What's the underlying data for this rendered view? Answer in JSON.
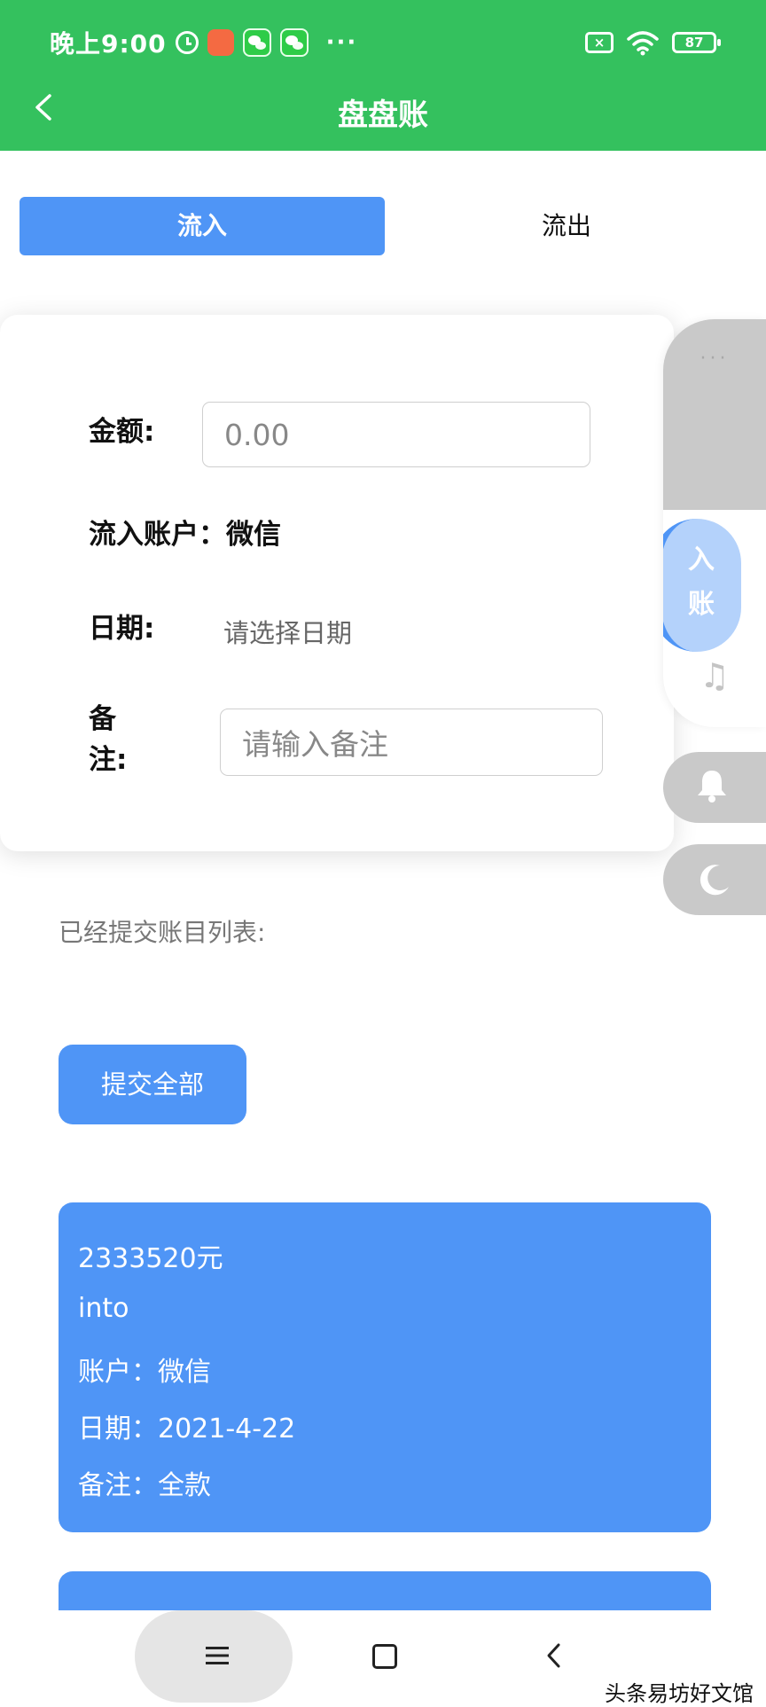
{
  "status_bar": {
    "time": "晚上9:00",
    "more": "···",
    "battery": "87",
    "sim": "×"
  },
  "header": {
    "title": "盘盘账"
  },
  "tabs": [
    {
      "label": "流入"
    },
    {
      "label": "流出"
    }
  ],
  "form": {
    "amount_label": "金额:",
    "amount_placeholder": "0.00",
    "account_label": "流入账户：微信",
    "date_label": "日期:",
    "date_placeholder": "请选择日期",
    "note_label_1": "备",
    "note_label_2": "注:",
    "note_placeholder": "请输入备注"
  },
  "float_menu": {
    "dots": "···",
    "active_1": "入",
    "active_2": "账",
    "music": "♫"
  },
  "list": {
    "title": "已经提交账目列表:",
    "submit_label": "提交全部",
    "entries": [
      {
        "amount": "2333520元",
        "type": "into",
        "account": "账户：微信",
        "date": "日期：2021-4-22",
        "note": "备注：全款"
      }
    ]
  },
  "watermark": "头条易坊好文馆"
}
